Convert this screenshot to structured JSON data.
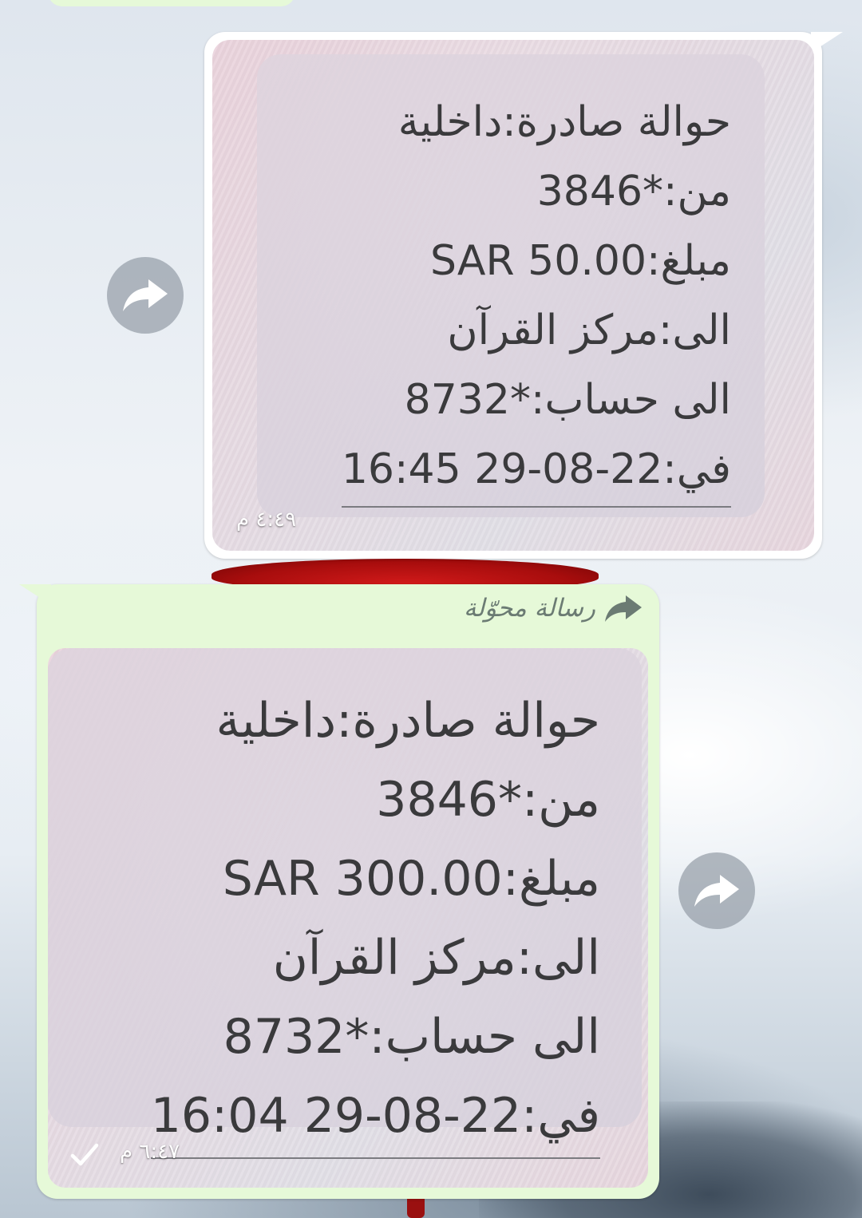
{
  "messages": [
    {
      "direction": "incoming",
      "sms_lines": [
        "حوالة صادرة:داخلية",
        "من:*3846",
        "مبلغ:SAR 50.00",
        "الى:مركز القرآن",
        "الى حساب:*8732",
        "في:22-08-29 16:45"
      ],
      "time": "٤:٤٩ م"
    },
    {
      "direction": "outgoing",
      "forwarded_label": "رسالة محوّلة",
      "sms_lines": [
        "حوالة صادرة:داخلية",
        "من:*3846",
        "مبلغ:SAR 300.00",
        "الى:مركز القرآن",
        "الى حساب:*8732",
        "في:22-08-29 16:04"
      ],
      "time": "٦:٤٧ م",
      "status_icon": "check-icon"
    }
  ],
  "icons": {
    "forward": "forward-arrow-icon",
    "check": "single-check-icon"
  },
  "colors": {
    "incoming_bubble": "#ffffff",
    "outgoing_bubble": "#e6f9d8",
    "forward_button": "#969ea8"
  }
}
